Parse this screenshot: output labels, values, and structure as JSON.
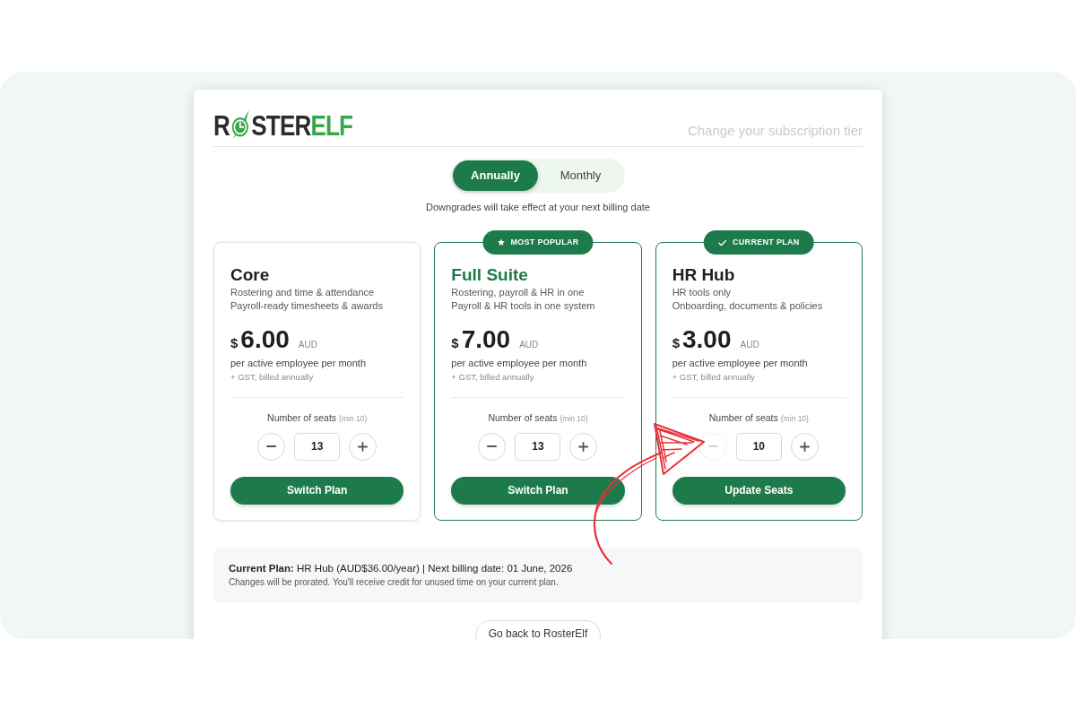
{
  "header": {
    "logo": {
      "lead": "R",
      "middle": "STER",
      "accent": "ELF"
    },
    "subtitle": "Change your subscription tier"
  },
  "billing_toggle": [
    {
      "label": "Annually",
      "selected": true
    },
    {
      "label": "Monthly",
      "selected": false
    }
  ],
  "notice": "Downgrades will take effect at your next billing date",
  "plans": [
    {
      "name": "Core",
      "featured": false,
      "lines": [
        "Rostering and time & attendance",
        "Payroll-ready timesheets & awards"
      ],
      "currency": "$",
      "price": "6.00",
      "unit": "AUD",
      "period": "per active employee per month",
      "tax_note": "+ GST, billed annually",
      "seats_label": "Number of seats",
      "seats_hint": "(min 10)",
      "seats": "13",
      "decrement_disabled": false,
      "action": "Switch Plan"
    },
    {
      "name": "Full Suite",
      "featured": true,
      "badge": {
        "kind": "popular",
        "label": "MOST POPULAR"
      },
      "lines": [
        "Rostering, payroll & HR in one",
        "Payroll & HR tools in one system"
      ],
      "currency": "$",
      "price": "7.00",
      "unit": "AUD",
      "period": "per active employee per month",
      "tax_note": "+ GST, billed annually",
      "seats_label": "Number of seats",
      "seats_hint": "(min 10)",
      "seats": "13",
      "decrement_disabled": false,
      "action": "Switch Plan"
    },
    {
      "name": "HR Hub",
      "featured": false,
      "badge": {
        "kind": "current",
        "label": "CURRENT PLAN"
      },
      "lines": [
        "HR tools only",
        "Onboarding, documents & policies"
      ],
      "currency": "$",
      "price": "3.00",
      "unit": "AUD",
      "period": "per active employee per month",
      "tax_note": "+ GST, billed annually",
      "seats_label": "Number of seats",
      "seats_hint": "(min 10)",
      "seats": "10",
      "decrement_disabled": true,
      "action": "Update Seats"
    }
  ],
  "summary": {
    "text": "**Current Plan:** HR Hub (AUD$36.00/year) | Next billing date: 01 June, 2026",
    "note": "Changes will be prorated. You'll receive credit for unused time on your current plan."
  },
  "back_button": "Go back to RosterElf"
}
